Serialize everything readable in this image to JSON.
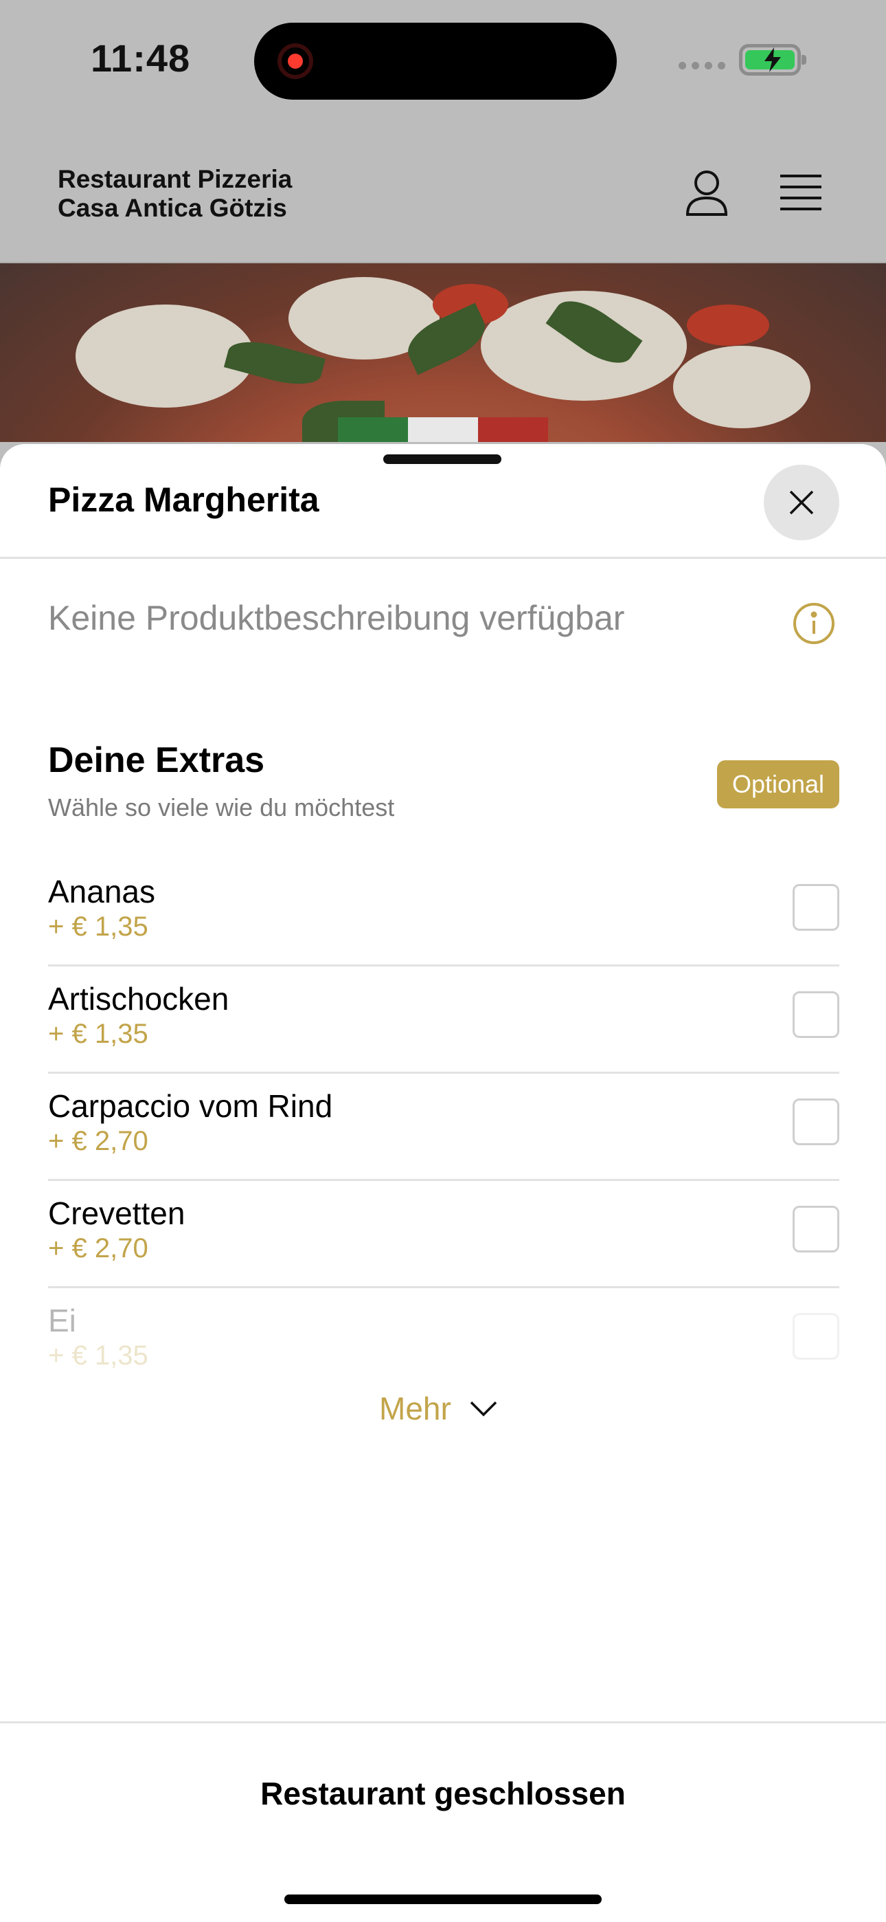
{
  "status_bar": {
    "time": "11:48"
  },
  "header": {
    "restaurant_name_line1": "Restaurant Pizzeria",
    "restaurant_name_line2": "Casa Antica Götzis"
  },
  "sheet": {
    "title": "Pizza Margherita",
    "description": "Keine Produktbeschreibung verfügbar",
    "extras": {
      "title": "Deine Extras",
      "subtitle": "Wähle so viele wie du möchtest",
      "badge": "Optional",
      "items": [
        {
          "name": "Ananas",
          "price": "+ € 1,35"
        },
        {
          "name": "Artischocken",
          "price": "+ € 1,35"
        },
        {
          "name": "Carpaccio vom Rind",
          "price": "+ € 2,70"
        },
        {
          "name": "Crevetten",
          "price": "+ € 2,70"
        },
        {
          "name": "Ei",
          "price": "+ € 1,35"
        }
      ],
      "more_label": "Mehr"
    },
    "footer_label": "Restaurant geschlossen"
  },
  "colors": {
    "accent": "#c2a44a",
    "battery": "#35c759",
    "recording": "#ff3b30"
  },
  "icons": [
    "record-icon",
    "battery-icon",
    "user-icon",
    "menu-icon",
    "close-icon",
    "info-icon",
    "chevron-down-icon"
  ]
}
